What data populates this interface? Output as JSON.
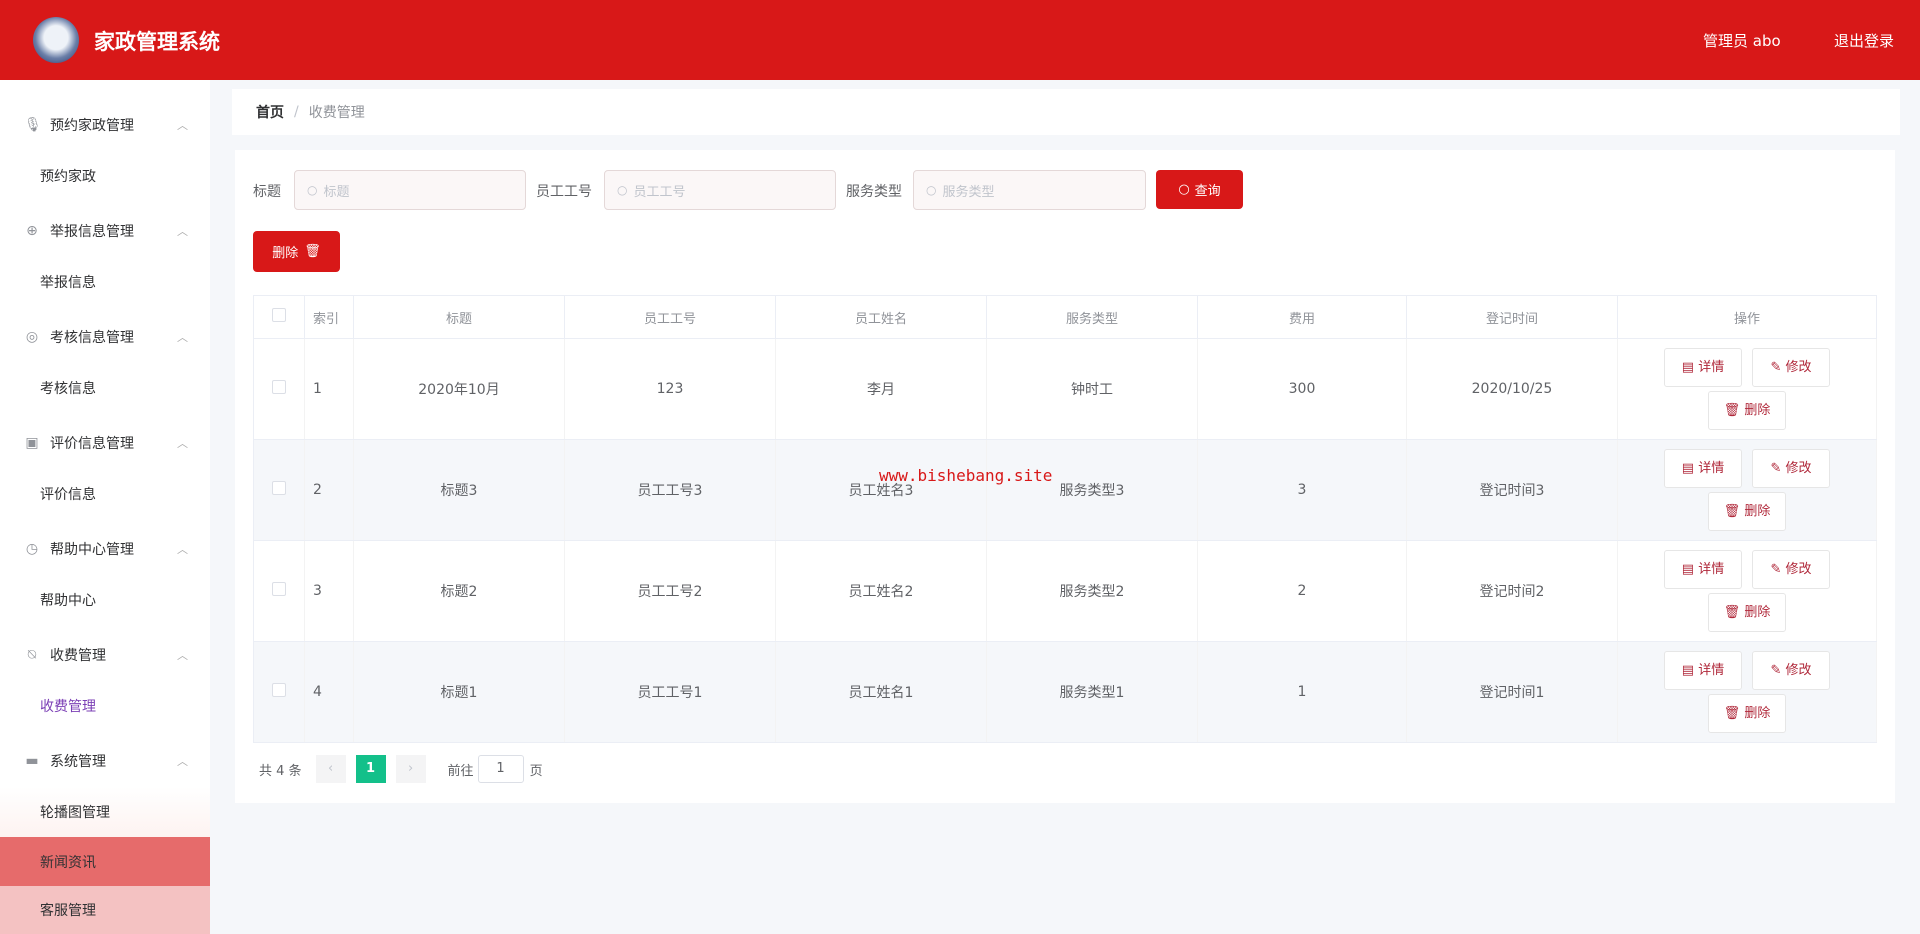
{
  "header": {
    "title": "家政管理系统",
    "user": "管理员 abo",
    "logout": "退出登录"
  },
  "sidebar": {
    "groups": [
      {
        "label": "预约家政管理",
        "icon": "microphone-icon",
        "glyph": "🎙",
        "sub": "预约家政"
      },
      {
        "label": "举报信息管理",
        "icon": "crosshair-icon",
        "glyph": "⊕",
        "sub": "举报信息"
      },
      {
        "label": "考核信息管理",
        "icon": "compass-icon",
        "glyph": "◎",
        "sub": "考核信息"
      },
      {
        "label": "评价信息管理",
        "icon": "clipboard-icon",
        "glyph": "▣",
        "sub": "评价信息"
      },
      {
        "label": "帮助中心管理",
        "icon": "clock-icon",
        "glyph": "◷",
        "sub": "帮助中心"
      },
      {
        "label": "收费管理",
        "icon": "bell-off-icon",
        "glyph": "⍉",
        "sub": "收费管理"
      },
      {
        "label": "系统管理",
        "icon": "ticket-icon",
        "glyph": "▬"
      }
    ],
    "system_items": [
      "轮播图管理",
      "新闻资讯",
      "客服管理"
    ]
  },
  "breadcrumb": {
    "home": "首页",
    "sep": "/",
    "current": "收费管理"
  },
  "search": {
    "title_label": "标题",
    "title_placeholder": "标题",
    "emp_label": "员工工号",
    "emp_placeholder": "员工工号",
    "type_label": "服务类型",
    "type_placeholder": "服务类型",
    "query": "查询"
  },
  "delete_label": "删除",
  "table": {
    "headers": [
      "索引",
      "标题",
      "员工工号",
      "员工姓名",
      "服务类型",
      "费用",
      "登记时间",
      "操作"
    ],
    "rows": [
      [
        "1",
        "2020年10月",
        "123",
        "李月",
        "钟时工",
        "300",
        "2020/10/25"
      ],
      [
        "2",
        "标题3",
        "员工工号3",
        "员工姓名3",
        "服务类型3",
        "3",
        "登记时间3"
      ],
      [
        "3",
        "标题2",
        "员工工号2",
        "员工姓名2",
        "服务类型2",
        "2",
        "登记时间2"
      ],
      [
        "4",
        "标题1",
        "员工工号1",
        "员工姓名1",
        "服务类型1",
        "1",
        "登记时间1"
      ]
    ],
    "actions": {
      "detail": "详情",
      "edit": "修改",
      "delete": "删除"
    }
  },
  "pagination": {
    "total": "共 4 条",
    "page": "1",
    "goto": "前往",
    "goto_value": "1",
    "page_suffix": "页"
  },
  "watermark": "www.bishebang.site"
}
